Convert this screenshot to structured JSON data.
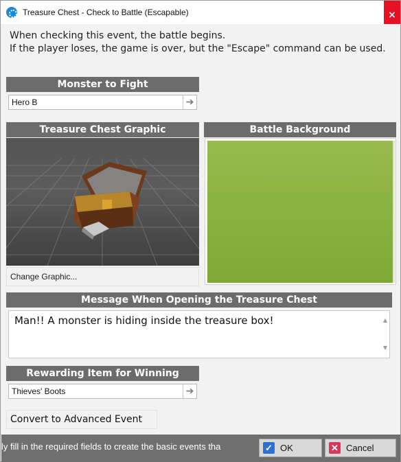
{
  "window": {
    "title": "Treasure Chest - Check to Battle (Escapable)",
    "close_glyph": "×"
  },
  "description": {
    "line1": "When checking this event, the battle begins.",
    "line2": "If the player loses, the game is over, but the \"Escape\" command can be used."
  },
  "monster": {
    "header": "Monster to Fight",
    "value": "Hero B"
  },
  "graphic": {
    "header": "Treasure Chest Graphic",
    "change_label": "Change Graphic..."
  },
  "battle_background": {
    "header": "Battle Background",
    "color": "#8cb442"
  },
  "message": {
    "header": "Message When Opening the Treasure Chest",
    "value": "Man!! A monster is hiding inside the treasure box!"
  },
  "reward": {
    "header": "Rewarding Item for Winning",
    "value": "Thieves' Boots"
  },
  "convert_label": "Convert to Advanced Event",
  "footer": {
    "hint": "ly fill in the required fields to create the basic events tha",
    "ok_label": "OK",
    "cancel_label": "Cancel",
    "ok_icon": "check-icon",
    "cancel_icon": "x-icon",
    "ok_icon_color": "#2d6fd3",
    "cancel_icon_color": "#d9365e"
  },
  "icons": {
    "arrow": "arrow-right-icon",
    "scroll_up": "▲",
    "scroll_down": "▼"
  }
}
